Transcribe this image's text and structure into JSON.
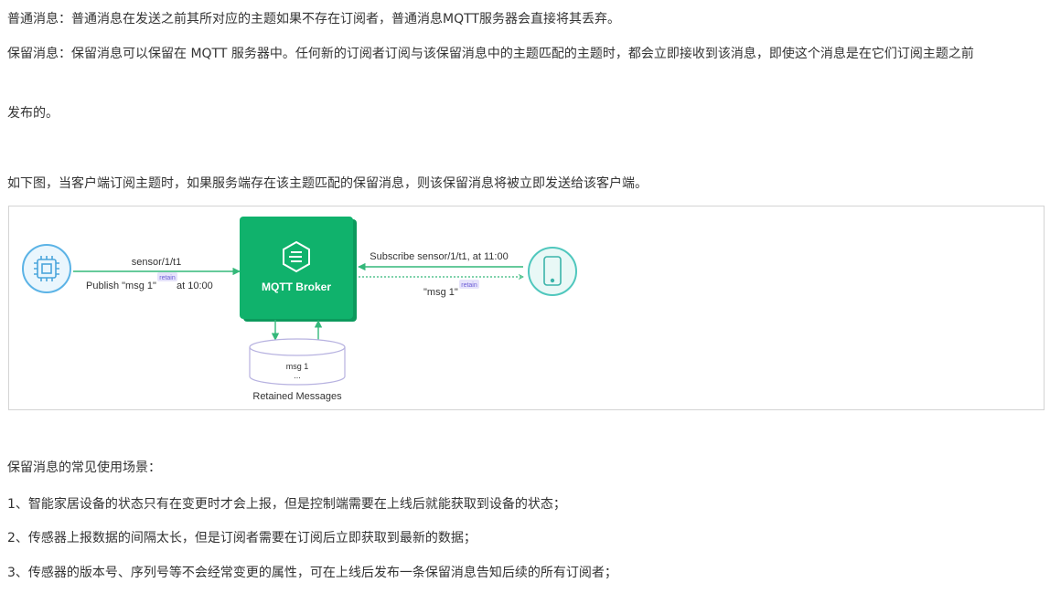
{
  "paragraphs": {
    "normal_message": "普通消息：普通消息在发送之前其所对应的主题如果不存在订阅者，普通消息MQTT服务器会直接将其丢弃。",
    "retained_message": "保留消息：保留消息可以保留在 MQTT 服务器中。任何新的订阅者订阅与该保留消息中的主题匹配的主题时，都会立即接收到该消息，即使这个消息是在它们订阅主题之前",
    "retained_message_cont": "发布的。",
    "figure_intro": "如下图，当客户端订阅主题时，如果服务端存在该主题匹配的保留消息，则该保留消息将被立即发送给该客户端。",
    "use_cases_title": "保留消息的常见使用场景：",
    "use_case_1": "1、智能家居设备的状态只有在变更时才会上报，但是控制端需要在上线后就能获取到设备的状态；",
    "use_case_2": "2、传感器上报数据的间隔太长，但是订阅者需要在订阅后立即获取到最新的数据；",
    "use_case_3": "3、传感器的版本号、序列号等不会经常变更的属性，可在上线后发布一条保留消息告知后续的所有订阅者；"
  },
  "diagram": {
    "broker_label": "MQTT Broker",
    "left_topic": "sensor/1/t1",
    "left_publish": "Publish \"msg 1\"",
    "left_time": "at 10:00",
    "retain_tag": "retain",
    "right_subscribe": "Subscribe sensor/1/t1, at 11:00",
    "right_msg": "\"msg 1\"",
    "store_msg": "msg 1",
    "store_dots": "...",
    "store_label": "Retained Messages",
    "colors": {
      "broker_green": "#10b26c",
      "circle_blue": "#5bb3e6",
      "circle_teal": "#4fc7bd",
      "arrow_green": "#34b87a",
      "retain_purple": "#6d5fd6",
      "retain_bg": "#e6e3fb",
      "store_stroke": "#b7b2e0"
    },
    "icons": {
      "left_device": "chip-icon",
      "right_device": "phone-icon",
      "broker": "emqx-logo-icon"
    }
  }
}
